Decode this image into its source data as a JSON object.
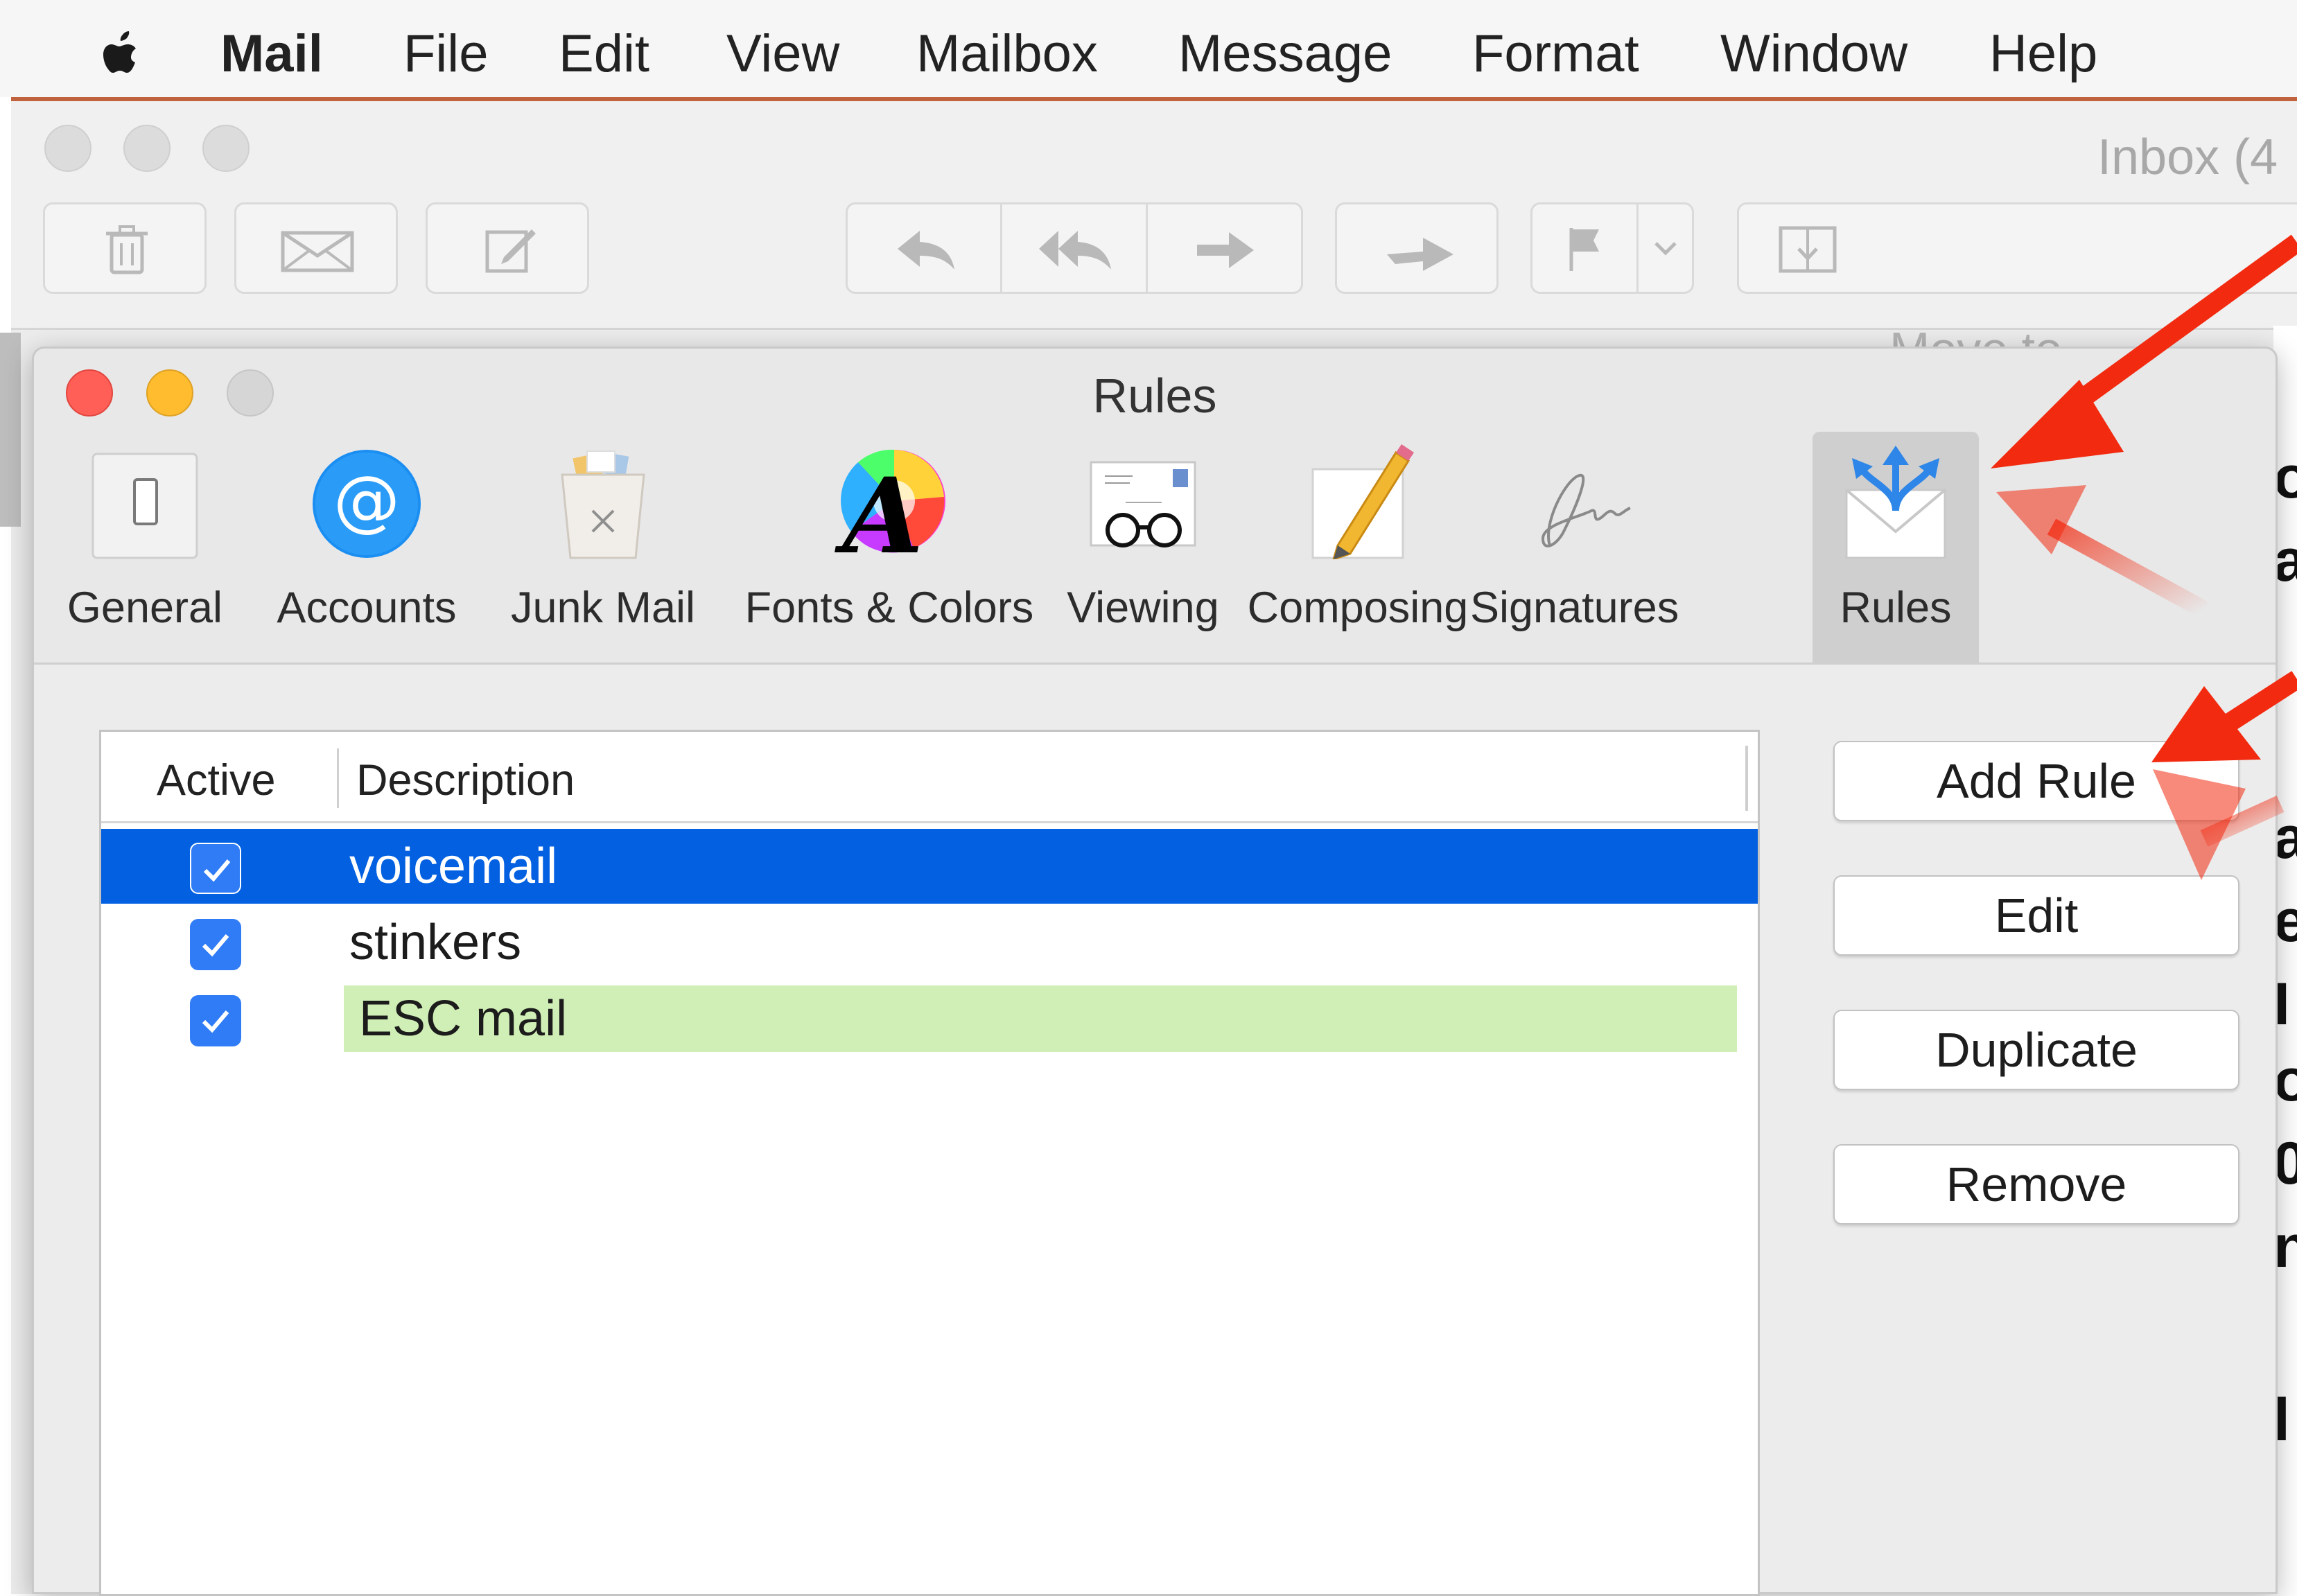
{
  "menubar": {
    "items": [
      "Mail",
      "File",
      "Edit",
      "View",
      "Mailbox",
      "Message",
      "Format",
      "Window",
      "Help"
    ]
  },
  "mail_window": {
    "title": "Inbox (4",
    "toolbar": {
      "move_label": "Move to..."
    }
  },
  "rules_window": {
    "title": "Rules",
    "tabs": [
      {
        "label": "General",
        "icon": "switch-icon"
      },
      {
        "label": "Accounts",
        "icon": "at-sign-icon"
      },
      {
        "label": "Junk Mail",
        "icon": "trash-can-icon"
      },
      {
        "label": "Fonts & Colors",
        "icon": "font-color-wheel-icon"
      },
      {
        "label": "Viewing",
        "icon": "glasses-envelope-icon"
      },
      {
        "label": "Composing",
        "icon": "pencil-paper-icon"
      },
      {
        "label": "Signatures",
        "icon": "signature-icon"
      },
      {
        "label": "Rules",
        "icon": "rules-envelope-icon"
      }
    ],
    "active_tab": "Rules",
    "table": {
      "headers": {
        "active": "Active",
        "description": "Description"
      },
      "rows": [
        {
          "description": "voicemail",
          "active": true,
          "selected": true
        },
        {
          "description": "stinkers",
          "active": true,
          "selected": false
        },
        {
          "description": "ESC mail",
          "active": true,
          "selected": false,
          "highlighted": true
        }
      ]
    },
    "buttons": {
      "add_rule": "Add Rule",
      "edit": "Edit",
      "duplicate": "Duplicate",
      "remove": "Remove"
    }
  },
  "colors": {
    "selection_blue": "#0260e1",
    "checkbox_blue": "#2f7cf6",
    "highlight_green": "#d0efb6",
    "arrow_red": "#f22a10",
    "close_red": "#ff5f57",
    "minimize_yellow": "#febc2e"
  }
}
